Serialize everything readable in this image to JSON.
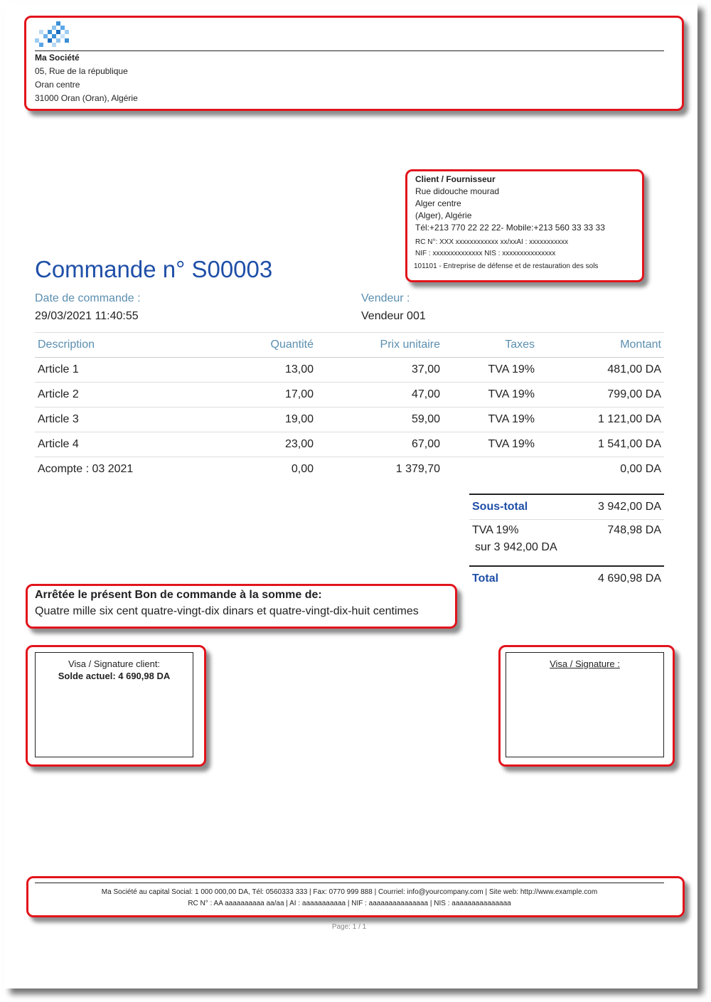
{
  "company": {
    "name": "Ma Société",
    "address_lines": [
      "05, Rue de la république",
      "Oran centre",
      "31000 Oran (Oran), Algérie"
    ]
  },
  "client": {
    "heading": "Client / Fournisseur",
    "lines": [
      "Rue didouche mourad",
      "Alger centre",
      "(Alger), Algérie",
      "Tél:+213 770 22 22 22- Mobile:+213 560 33 33 33"
    ],
    "rc": "RC N°: XXX xxxxxxxxxxxx xx/xxAI : xxxxxxxxxxx",
    "nif": "NIF : xxxxxxxxxxxxxx NIS : xxxxxxxxxxxxxxx",
    "activity": "101101 - Entreprise de défense et de restauration des sols"
  },
  "order": {
    "title": "Commande n° S00003",
    "date_label": "Date de commande :",
    "date_value": "29/03/2021 11:40:55",
    "seller_label": "Vendeur :",
    "seller_value": "Vendeur 001"
  },
  "table": {
    "headers": [
      "Description",
      "Quantité",
      "Prix unitaire",
      "Taxes",
      "Montant"
    ],
    "rows": [
      [
        "Article 1",
        "13,00",
        "37,00",
        "TVA 19%",
        "481,00 DA"
      ],
      [
        "Article 2",
        "17,00",
        "47,00",
        "TVA 19%",
        "799,00 DA"
      ],
      [
        "Article 3",
        "19,00",
        "59,00",
        "TVA 19%",
        "1 121,00 DA"
      ],
      [
        "Article 4",
        "23,00",
        "67,00",
        "TVA 19%",
        "1 541,00 DA"
      ],
      [
        "Acompte : 03 2021",
        "0,00",
        "1 379,70",
        "",
        "0,00 DA"
      ]
    ]
  },
  "totals": {
    "subtotal_label": "Sous-total",
    "subtotal_value": "3 942,00 DA",
    "tax_label": "TVA 19%",
    "tax_base": "sur 3 942,00 DA",
    "tax_value": "748,98 DA",
    "total_label": "Total",
    "total_value": "4 690,98 DA"
  },
  "amount_words": {
    "heading": "Arrêtée le présent Bon de commande à la somme de:",
    "text": "Quatre mille six cent quatre-vingt-dix dinars et quatre-vingt-dix-huit centimes"
  },
  "signature_client": {
    "title": "Visa / Signature client:",
    "balance": "Solde actuel: 4 690,98 DA"
  },
  "signature_company": {
    "title": "Visa / Signature :"
  },
  "footer": {
    "line1": "Ma Société au capital Social: 1 000 000,00 DA, Tél: 0560333 333 | Fax: 0770 999 888 | Courriel: info@yourcompany.com | Site web: http://www.example.com",
    "line2": "RC N° : AA aaaaaaaaaa aa/aa | AI : aaaaaaaaaaa | NIF : aaaaaaaaaaaaaaa | NIS : aaaaaaaaaaaaaaa",
    "page": "Page: 1 / 1"
  },
  "colors": {
    "highlight_border": "#e2141c",
    "title_blue": "#1f4fa8",
    "label_blue": "#5b8fb0"
  }
}
